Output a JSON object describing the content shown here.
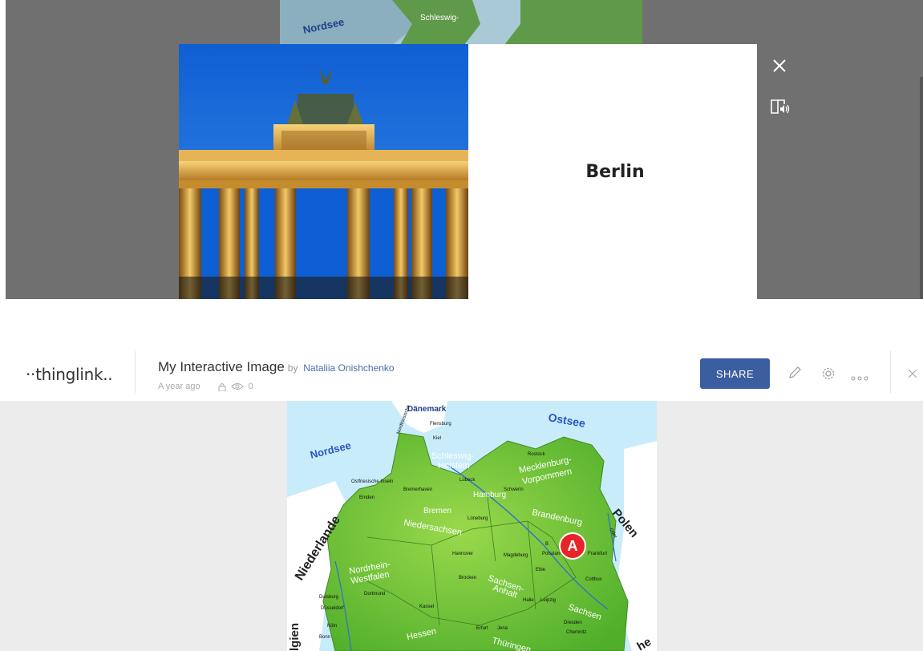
{
  "overlay": {
    "title": "Berlin",
    "close_icon": "close-icon",
    "audio_icon": "immersive-reader-icon"
  },
  "header": {
    "logo": "··thinglink..",
    "title": "My Interactive Image",
    "by_label": "by",
    "author": "Nataliia Onishchenko",
    "timestamp": "A year ago",
    "view_count": "0",
    "share_label": "SHARE",
    "edit_icon": "pencil-icon",
    "settings_icon": "gear-icon",
    "more_icon": "more-dots-icon",
    "close_icon": "close-icon",
    "share_color": "#3b5ea0"
  },
  "map": {
    "labels": {
      "nordsee": "Nordsee",
      "ostsee": "Ostsee",
      "daenemark": "Dänemark",
      "polen": "Polen",
      "niederlande": "Niederlande",
      "belgien": "lgien",
      "schleswig": "Schleswig-",
      "holstein": "Holstein",
      "meck1": "Mecklenburg-",
      "meck2": "Vorpommern",
      "brandenburg": "Brandenburg",
      "niedersachsen": "Niedersachsen",
      "bremen": "Bremen",
      "hamburg": "Hamburg",
      "nrw1": "Nordrhein-",
      "nrw2": "Westfalen",
      "sa1": "Sachsen-",
      "sa2": "Anhalt",
      "sachsen": "Sachsen",
      "hessen": "Hessen",
      "thueringen": "Thüringen",
      "kiel": "Kiel",
      "flensburg": "Flensburg",
      "rostock": "Rostock",
      "luebeck": "Lübeck",
      "schwerin": "Schwerin",
      "emden": "Emden",
      "bremerhaven": "Bremerhaven",
      "lueneburg": "Lüneburg",
      "hannover": "Hannover",
      "magdeburg": "Magdeburg",
      "potsdam": "Potsdam",
      "frankfurt": "Frankfurt",
      "oder": "Oder",
      "elbe": "Elbe",
      "cottbus": "Cottbus",
      "dortmund": "Dortmund",
      "duisburg": "Duisburg",
      "duesseldorf": "Düsseldorf",
      "koeln": "Köln",
      "bonn": "Bonn",
      "kassel": "Kassel",
      "halle": "Halle",
      "leipzig": "Leipzig",
      "dresden": "Dresden",
      "chemnitz": "Chemnitz",
      "erfurt": "Erfurt",
      "jena": "Jena",
      "brocken": "Brocken",
      "ostfries": "Ostfriesische Inseln",
      "nordfries": "Nordfriesische",
      "he": "he",
      "berlin_abbr": "B"
    },
    "marker_label": "A"
  }
}
